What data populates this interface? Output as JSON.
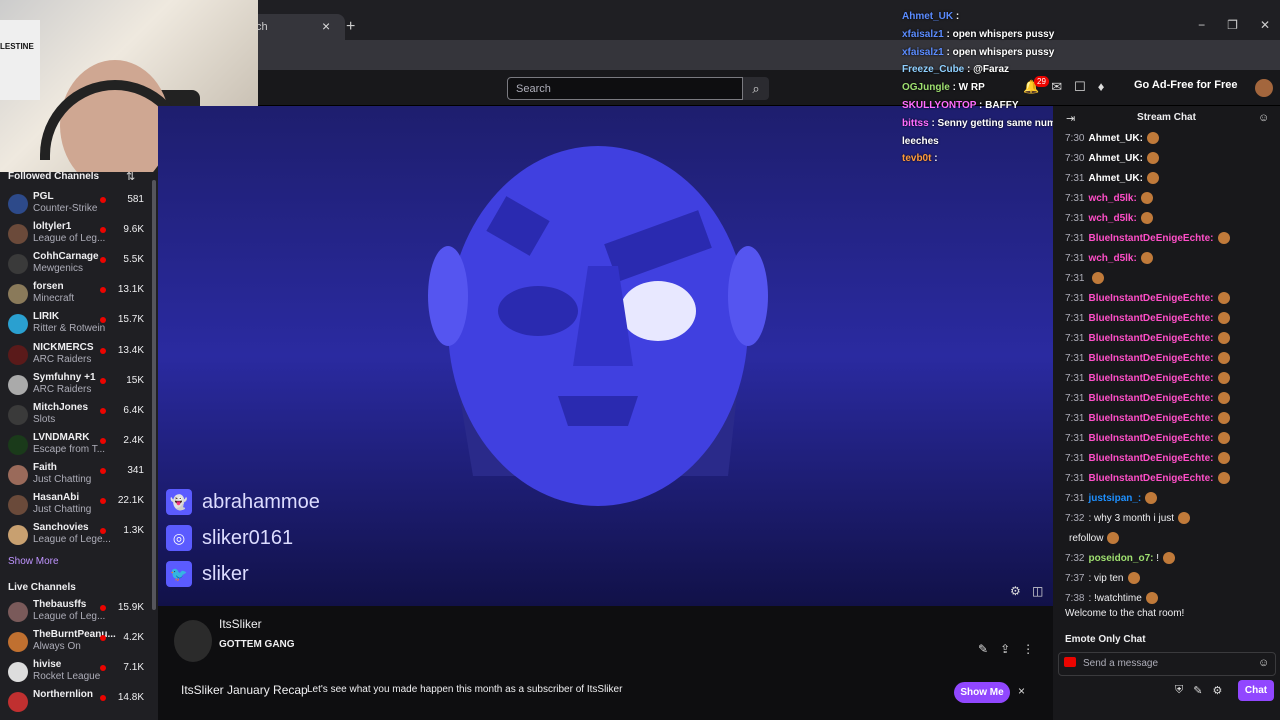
{
  "browser": {
    "tab_title": "ch",
    "close": "×",
    "plus": "+",
    "controls": [
      "−",
      "❐",
      "✕"
    ]
  },
  "topnav": {
    "search_placeholder": "Search",
    "adfree": "Go Ad-Free for Free",
    "notif_count": "29"
  },
  "sidebar": {
    "followed_title": "Followed Channels",
    "followed": [
      {
        "name": "PGL",
        "game": "Counter-Strike",
        "viewers": "581",
        "color": "#2d4a8a"
      },
      {
        "name": "loltyler1",
        "game": "League of Leg...",
        "viewers": "9.6K",
        "color": "#6b4a3a"
      },
      {
        "name": "CohhCarnage",
        "game": "Mewgenics",
        "viewers": "5.5K",
        "color": "#3a3a3a"
      },
      {
        "name": "forsen",
        "game": "Minecraft",
        "viewers": "13.1K",
        "color": "#8a7a5a"
      },
      {
        "name": "LIRIK",
        "game": "Ritter & Rotwein",
        "viewers": "15.7K",
        "color": "#2aa0d0"
      },
      {
        "name": "NICKMERCS",
        "game": "ARC Raiders",
        "viewers": "13.4K",
        "color": "#5a1a1a"
      },
      {
        "name": "Symfuhny +1",
        "game": "ARC Raiders",
        "viewers": "15K",
        "color": "#aaa"
      },
      {
        "name": "MitchJones",
        "game": "Slots",
        "viewers": "6.4K",
        "color": "#3a3a3a"
      },
      {
        "name": "LVNDMARK",
        "game": "Escape from T...",
        "viewers": "2.4K",
        "color": "#1a3a1a"
      },
      {
        "name": "Faith",
        "game": "Just Chatting",
        "viewers": "341",
        "color": "#9a6a5a"
      },
      {
        "name": "HasanAbi",
        "game": "Just Chatting",
        "viewers": "22.1K",
        "color": "#6a4a3a"
      },
      {
        "name": "Sanchovies",
        "game": "League of Lege...",
        "viewers": "1.3K",
        "color": "#c8a070"
      }
    ],
    "show_more": "Show More",
    "live_title": "Live Channels",
    "live": [
      {
        "name": "Thebausffs",
        "game": "League of Leg...",
        "viewers": "15.9K",
        "color": "#7a5a5a"
      },
      {
        "name": "TheBurntPeanu...",
        "game": "Always On",
        "viewers": "4.2K",
        "color": "#c07030"
      },
      {
        "name": "hivise",
        "game": "Rocket League",
        "viewers": "7.1K",
        "color": "#ddd"
      },
      {
        "name": "Northernlion",
        "game": "",
        "viewers": "14.8K",
        "color": "#c03030"
      }
    ]
  },
  "player": {
    "socials": [
      {
        "icon": "snapchat-icon",
        "glyph": "👻",
        "handle": "abrahammoe"
      },
      {
        "icon": "instagram-icon",
        "glyph": "◎",
        "handle": "sliker0161"
      },
      {
        "icon": "twitter-icon",
        "glyph": "🐦",
        "handle": "sliker"
      }
    ]
  },
  "overlay_chat": [
    {
      "user": "Ahmet_UK",
      "msg": " :",
      "color": "#5b8cff"
    },
    {
      "user": "xfaisalz1",
      "msg": " : open whispers pussy",
      "color": "#5b8cff"
    },
    {
      "user": "xfaisalz1",
      "msg": " : open whispers pussy",
      "color": "#5b8cff"
    },
    {
      "user": "Freeze_Cube",
      "msg": " : @Faraz",
      "color": "#8fd0ff"
    },
    {
      "user": "OGJungle",
      "msg": " : W RP",
      "color": "#9fe070"
    },
    {
      "user": "SKULLYONTOP",
      "msg": " :   BAFFY",
      "color": "#ff6cff"
    },
    {
      "user": "bittss",
      "msg": " : Senny getting same numbers than Russel even tho both were Miz",
      "color": "#ff6cff"
    },
    {
      "user": "leeches",
      "msg": "",
      "color": "#ffffff"
    },
    {
      "user": "tevb0t",
      "msg": " :",
      "color": "#ff9a3a"
    }
  ],
  "stream": {
    "streamer": "ItsSliker",
    "title": "GOTTEM GANG",
    "recap_title": "ItsSliker January Recap",
    "recap_desc": "Let's see what you made happen this month as a subscriber of ItsSliker",
    "show_me": "Show Me",
    "close": "×"
  },
  "chat": {
    "header": "Stream Chat",
    "messages": [
      {
        "time": "7:30",
        "user": "Ahmet_UK:",
        "msg": "",
        "color": "#ffffff"
      },
      {
        "time": "7:30",
        "user": "Ahmet_UK:",
        "msg": "",
        "color": "#ffffff"
      },
      {
        "time": "7:31",
        "user": "Ahmet_UK:",
        "msg": "",
        "color": "#ffffff"
      },
      {
        "time": "7:31",
        "user": "wch_d5lk:",
        "msg": "",
        "color": "#ff4fc8"
      },
      {
        "time": "7:31",
        "user": "wch_d5lk:",
        "msg": "",
        "color": "#ff4fc8"
      },
      {
        "time": "7:31",
        "user": "BlueInstantDeEnigeEchte:",
        "msg": "",
        "color": "#ff4fc8"
      },
      {
        "time": "7:31",
        "user": "wch_d5lk:",
        "msg": "",
        "color": "#ff4fc8"
      },
      {
        "time": "7:31",
        "user": "",
        "msg": "",
        "color": "#1e90ff"
      },
      {
        "time": "7:31",
        "user": "BlueInstantDeEnigeEchte:",
        "msg": "",
        "color": "#ff4fc8"
      },
      {
        "time": "7:31",
        "user": "BlueInstantDeEnigeEchte:",
        "msg": "",
        "color": "#ff4fc8"
      },
      {
        "time": "7:31",
        "user": "BlueInstantDeEnigeEchte:",
        "msg": "",
        "color": "#ff4fc8"
      },
      {
        "time": "7:31",
        "user": "BlueInstantDeEnigeEchte:",
        "msg": "",
        "color": "#ff4fc8"
      },
      {
        "time": "7:31",
        "user": "BlueInstantDeEnigeEchte:",
        "msg": "",
        "color": "#ff4fc8"
      },
      {
        "time": "7:31",
        "user": "BlueInstantDeEnigeEchte:",
        "msg": "",
        "color": "#ff4fc8"
      },
      {
        "time": "7:31",
        "user": "BlueInstantDeEnigeEchte:",
        "msg": "",
        "color": "#ff4fc8"
      },
      {
        "time": "7:31",
        "user": "BlueInstantDeEnigeEchte:",
        "msg": "",
        "color": "#ff4fc8"
      },
      {
        "time": "7:31",
        "user": "BlueInstantDeEnigeEchte:",
        "msg": "",
        "color": "#ff4fc8"
      },
      {
        "time": "7:31",
        "user": "BlueInstantDeEnigeEchte:",
        "msg": "",
        "color": "#ff4fc8"
      },
      {
        "time": "7:31",
        "user": "justsipan_:",
        "msg": "",
        "color": "#1e90ff"
      },
      {
        "time": "7:32",
        "user": "",
        "msg": ": why 3 month i just",
        "color": "#ff3030"
      },
      {
        "time": "",
        "user": "",
        "msg": "refollow",
        "color": "#ffffff"
      },
      {
        "time": "7:32",
        "user": "poseidon_o7:",
        "msg": " !",
        "color": "#9fe070"
      },
      {
        "time": "7:37",
        "user": "",
        "msg": ": vip ten",
        "color": "#1e3aff"
      },
      {
        "time": "7:38",
        "user": "",
        "msg": ": !watchtime",
        "color": "#1e3aff"
      }
    ],
    "welcome": "Welcome to the chat room!",
    "emote_only": "Emote Only Chat",
    "input_placeholder": "Send a message",
    "chat_button": "Chat"
  }
}
